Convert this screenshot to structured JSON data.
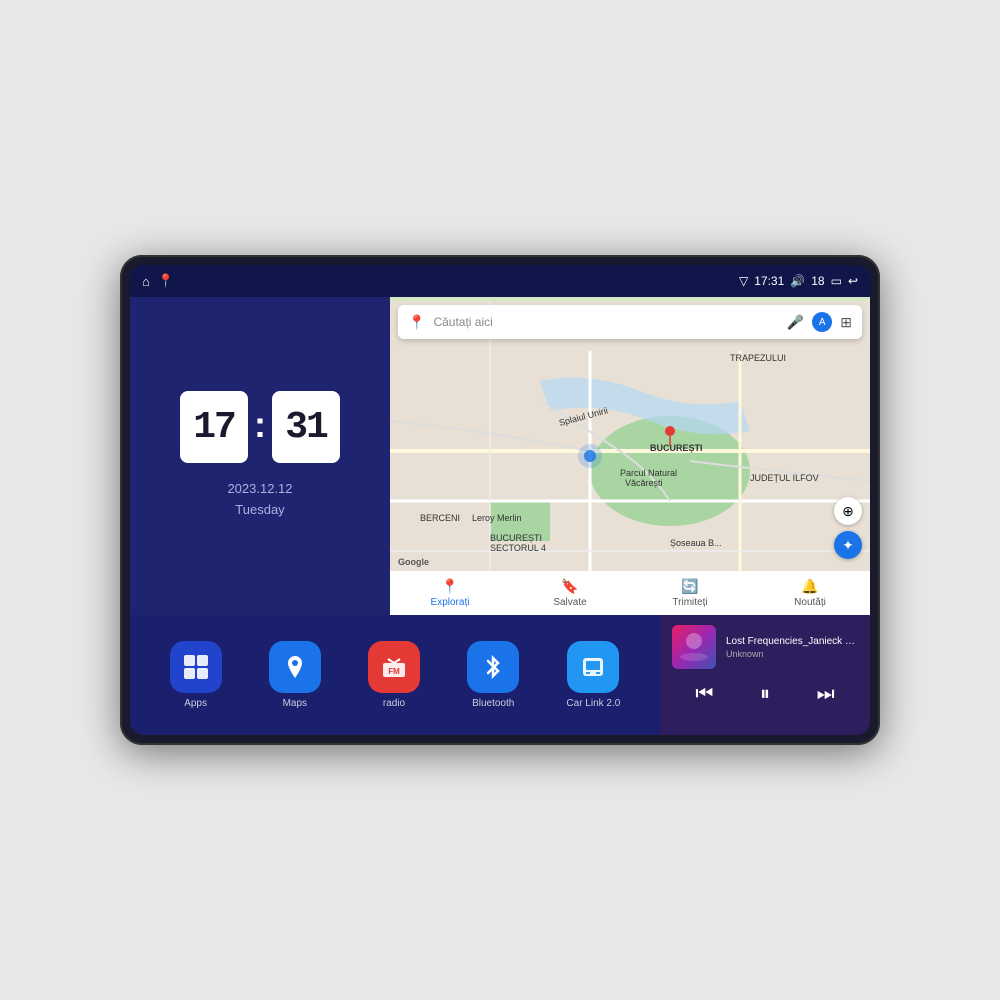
{
  "device": {
    "status_bar": {
      "signal_icon": "▽",
      "time": "17:31",
      "volume_icon": "🔊",
      "battery_level": "18",
      "battery_icon": "▭",
      "back_icon": "↩",
      "home_icon": "⌂",
      "maps_status_icon": "📍"
    },
    "clock": {
      "hour": "17",
      "minute": "31",
      "date": "2023.12.12",
      "day": "Tuesday"
    },
    "map": {
      "search_placeholder": "Căutați aici",
      "areas": [
        "TRAPEZULUI",
        "BUCUREȘTI",
        "JUDEȚUL ILFOV",
        "BERCENI"
      ],
      "places": [
        "Parcul Natural Văcărești",
        "Leroy Merlin",
        "BUCUREȘTI SECTORUL 4"
      ],
      "nav_items": [
        {
          "label": "Explorați",
          "icon": "📍",
          "active": true
        },
        {
          "label": "Salvate",
          "icon": "🔖",
          "active": false
        },
        {
          "label": "Trimiteți",
          "icon": "🔄",
          "active": false
        },
        {
          "label": "Noutăți",
          "icon": "🔔",
          "active": false
        }
      ]
    },
    "apps": [
      {
        "id": "apps",
        "label": "Apps",
        "icon": "⊞",
        "color": "#2244cc"
      },
      {
        "id": "maps",
        "label": "Maps",
        "icon": "🗺",
        "color": "#1a73e8"
      },
      {
        "id": "radio",
        "label": "radio",
        "icon": "📻",
        "color": "#e53935"
      },
      {
        "id": "bluetooth",
        "label": "Bluetooth",
        "icon": "⚡",
        "color": "#1a73e8"
      },
      {
        "id": "carlink",
        "label": "Car Link 2.0",
        "icon": "📱",
        "color": "#2196f3"
      }
    ],
    "music": {
      "title": "Lost Frequencies_Janieck Devy-...",
      "artist": "Unknown",
      "prev_icon": "⏮",
      "play_icon": "⏸",
      "next_icon": "⏭"
    }
  }
}
